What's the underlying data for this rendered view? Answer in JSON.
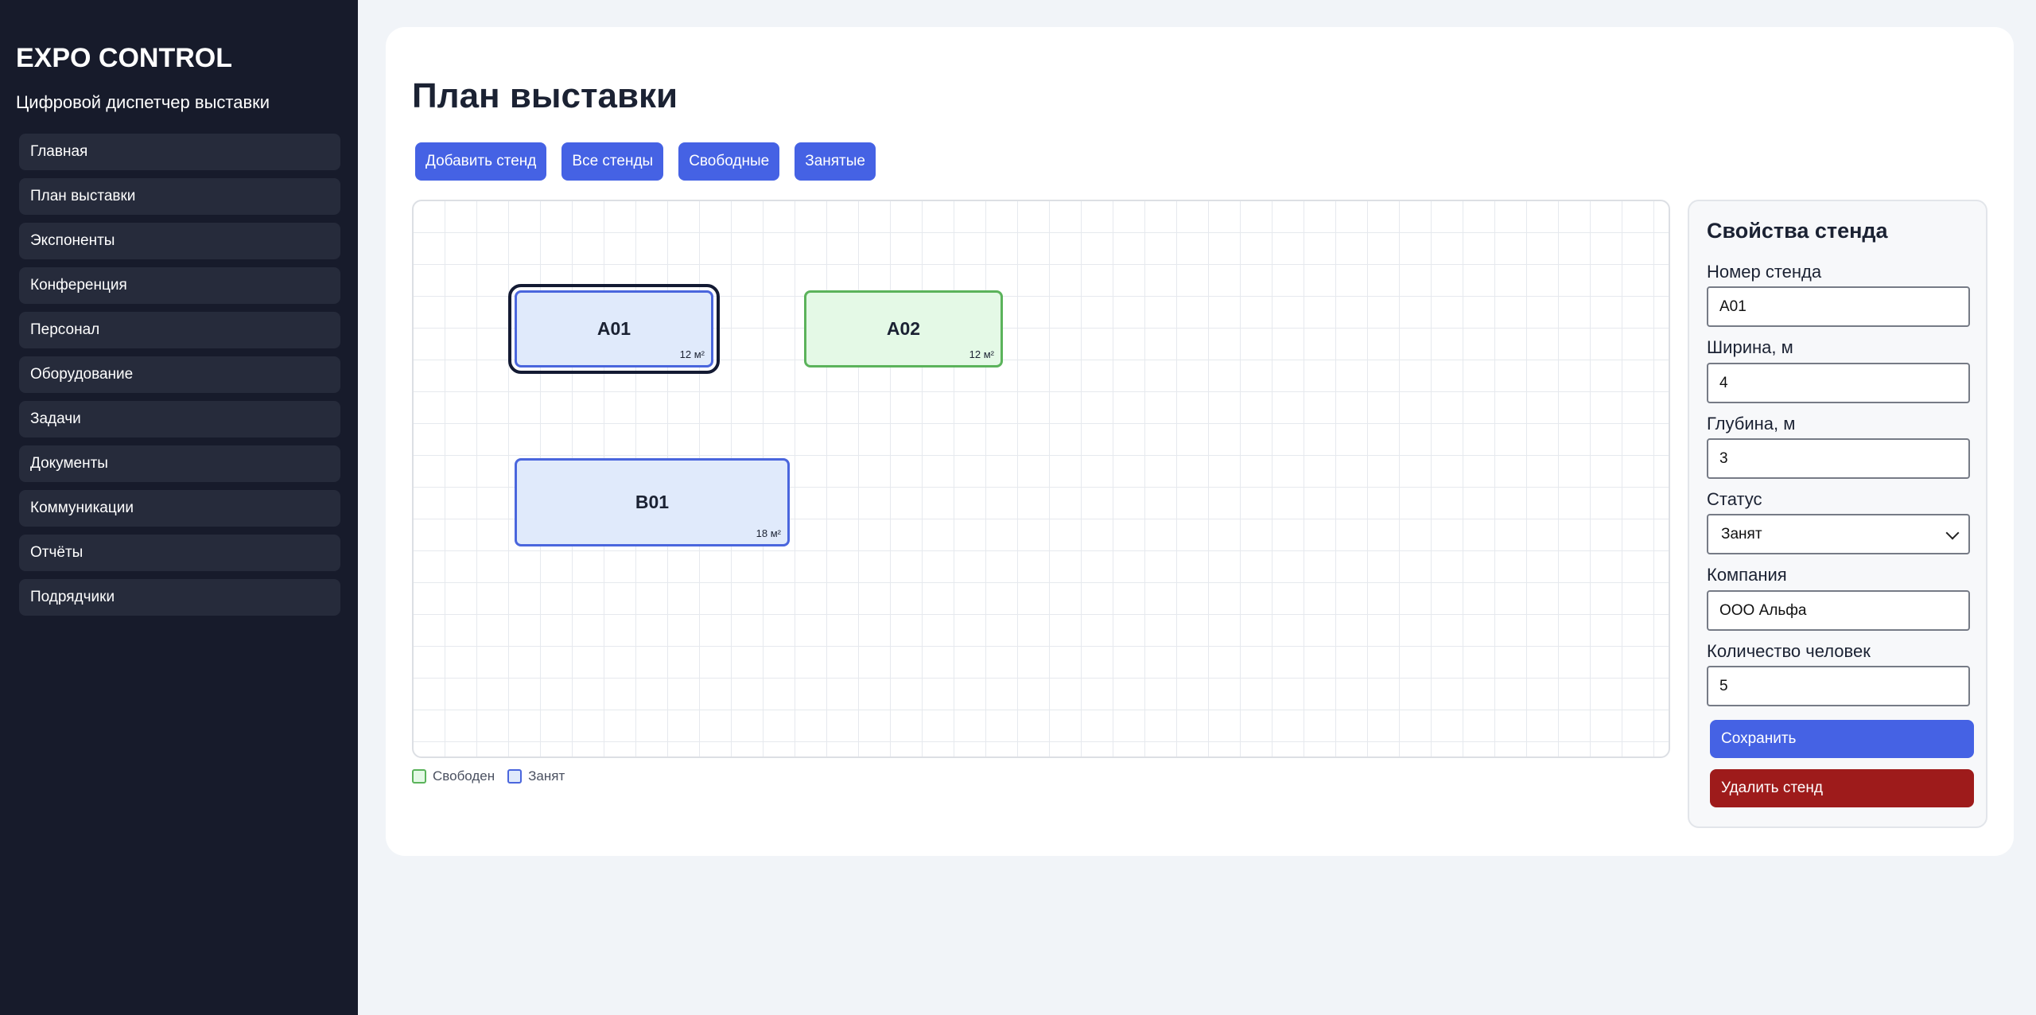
{
  "sidebar": {
    "brand": "EXPO CONTROL",
    "subtitle": "Цифровой диспетчер выставки",
    "items": [
      {
        "label": "Главная"
      },
      {
        "label": "План выставки"
      },
      {
        "label": "Экспоненты"
      },
      {
        "label": "Конференция"
      },
      {
        "label": "Персонал"
      },
      {
        "label": "Оборудование"
      },
      {
        "label": "Задачи"
      },
      {
        "label": "Документы"
      },
      {
        "label": "Коммуникации"
      },
      {
        "label": "Отчёты"
      },
      {
        "label": "Подрядчики"
      }
    ]
  },
  "main": {
    "title": "План выставки",
    "toolbar": {
      "add": "Добавить стенд",
      "all": "Все стенды",
      "free": "Свободные",
      "busy": "Занятые"
    }
  },
  "plan": {
    "stands": [
      {
        "number": "A01",
        "area": "12 м²",
        "status": "busy",
        "selected": true
      },
      {
        "number": "A02",
        "area": "12 м²",
        "status": "free",
        "selected": false
      },
      {
        "number": "B01",
        "area": "18 м²",
        "status": "busy",
        "selected": false
      }
    ],
    "legend": {
      "free": "Свободен",
      "busy": "Занят"
    }
  },
  "properties": {
    "title": "Свойства стенда",
    "number": {
      "label": "Номер стенда",
      "value": "A01"
    },
    "width": {
      "label": "Ширина, м",
      "value": "4"
    },
    "depth": {
      "label": "Глубина, м",
      "value": "3"
    },
    "status": {
      "label": "Статус",
      "value": "Занят"
    },
    "company": {
      "label": "Компания",
      "value": "ООО Альфа"
    },
    "people": {
      "label": "Количество человек",
      "value": "5"
    },
    "save": "Сохранить",
    "delete": "Удалить стенд"
  },
  "colors": {
    "sidebar_bg": "#171b2b",
    "accent": "#4562e4",
    "danger": "#9e1b1b",
    "busy_border": "#4a66dd",
    "free_border": "#5bb35b"
  }
}
